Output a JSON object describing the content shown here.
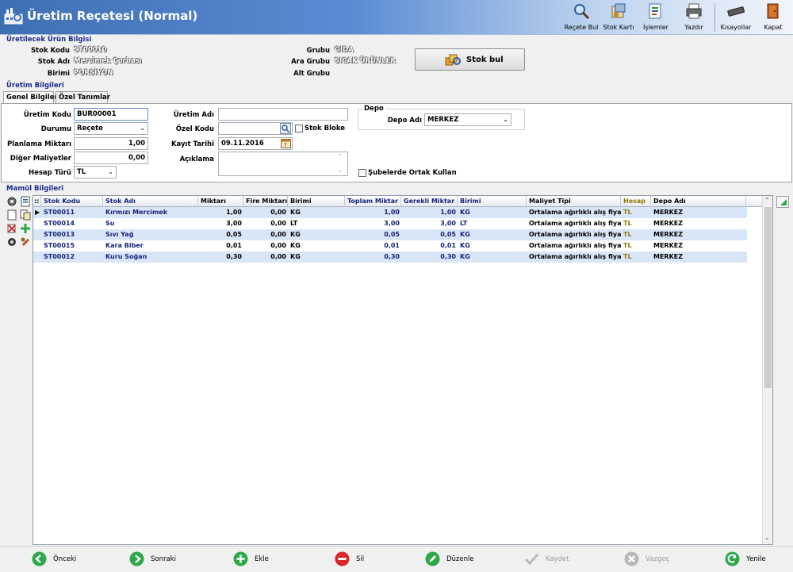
{
  "window": {
    "title": "Üretim Reçetesi (Normal)"
  },
  "toolbar": {
    "items": [
      {
        "label": "Reçete Bul",
        "icon": "magnifier-icon"
      },
      {
        "label": "Stok Kartı",
        "icon": "stock-card-icon"
      },
      {
        "label": "İşlemler",
        "icon": "operations-icon"
      },
      {
        "label": "Yazdır",
        "icon": "printer-icon"
      },
      {
        "label": "Kısayollar",
        "icon": "keyboard-icon"
      },
      {
        "label": "Kapat",
        "icon": "exit-door-icon"
      }
    ]
  },
  "product_info": {
    "section_title": "Üretilecek Ürün Bilgisi",
    "stok_kodu_label": "Stok Kodu",
    "stok_kodu": "ST00010",
    "stok_adi_label": "Stok Adı",
    "stok_adi": "Mercimek Çorbası",
    "birimi_label": "Birimi",
    "birimi": "PORSİYON",
    "grubu_label": "Grubu",
    "grubu": "GIDA",
    "ara_grubu_label": "Ara Grubu",
    "ara_grubu": "SICAK ÜRÜNLER",
    "alt_grubu_label": "Alt Grubu",
    "alt_grubu": "",
    "stok_bul_button": "Stok bul"
  },
  "production_info": {
    "section_title": "Üretim Bilgileri",
    "tabs": [
      {
        "label": "Genel Bilgiler",
        "active": true
      },
      {
        "label": "Özel Tanımlar",
        "active": false
      }
    ],
    "uretim_kodu_label": "Üretim Kodu",
    "uretim_kodu": "BUR00001",
    "durumu_label": "Durumu",
    "durumu": "Reçete",
    "planlama_miktari_label": "Planlama Miktarı",
    "planlama_miktari": "1,00",
    "diger_maliyetler_label": "Diğer Maliyetler",
    "diger_maliyetler": "0,00",
    "hesap_turu_label": "Hesap Türü",
    "hesap_turu": "TL",
    "uretim_adi_label": "Üretim Adı",
    "uretim_adi": "",
    "ozel_kodu_label": "Özel Kodu",
    "ozel_kodu": "",
    "stok_bloke_label": "Stok Bloke",
    "kayit_tarihi_label": "Kayıt Tarihi",
    "kayit_tarihi": "09.11.2016",
    "aciklama_label": "Açıklama",
    "aciklama": "",
    "depo_group_label": "Depo",
    "depo_adi_label": "Depo Adı",
    "depo_adi": "MERKEZ",
    "subelerde_label": "Şubelerde Ortak Kullan"
  },
  "materials": {
    "section_title": "Mamül Bilgileri",
    "columns": [
      "Stok Kodu",
      "Stok Adı",
      "Miktarı",
      "Fire Miktarı",
      "Birimi",
      "Toplam Miktar",
      "Gerekli Miktar",
      "Birimi",
      "Maliyet Tipi",
      "Hesap",
      "Depo Adı"
    ],
    "rows": [
      [
        "ST00011",
        "Kırmızı Mercimek",
        "1,00",
        "0,00",
        "KG",
        "1,00",
        "1,00",
        "KG",
        "Ortalama ağırlıklı alış fiyatı",
        "TL",
        "MERKEZ"
      ],
      [
        "ST00014",
        "Su",
        "3,00",
        "0,00",
        "LT",
        "3,00",
        "3,00",
        "LT",
        "Ortalama ağırlıklı alış fiyatı",
        "TL",
        "MERKEZ"
      ],
      [
        "ST00013",
        "Sıvı Yağ",
        "0,05",
        "0,00",
        "KG",
        "0,05",
        "0,05",
        "KG",
        "Ortalama ağırlıklı alış fiyatı",
        "TL",
        "MERKEZ"
      ],
      [
        "ST00015",
        "Kara Biber",
        "0,01",
        "0,00",
        "KG",
        "0,01",
        "0,01",
        "KG",
        "Ortalama ağırlıklı alış fiyatı",
        "TL",
        "MERKEZ"
      ],
      [
        "ST00012",
        "Kuru Soğan",
        "0,30",
        "0,00",
        "KG",
        "0,30",
        "0,30",
        "KG",
        "Ortalama ağırlıklı alış fiyatı",
        "TL",
        "MERKEZ"
      ]
    ]
  },
  "footer": {
    "buttons": [
      {
        "label": "Önceki",
        "color": "#2fa84a",
        "enabled": true
      },
      {
        "label": "Sonraki",
        "color": "#2fa84a",
        "enabled": true
      },
      {
        "label": "Ekle",
        "color": "#2fa84a",
        "enabled": true
      },
      {
        "label": "Sil",
        "color": "#d8262a",
        "enabled": true
      },
      {
        "label": "Düzenle",
        "color": "#2fa84a",
        "enabled": true
      },
      {
        "label": "Kaydet",
        "color": "#b8b8b8",
        "enabled": false
      },
      {
        "label": "Vazgeç",
        "color": "#b8b8b8",
        "enabled": false
      },
      {
        "label": "Yenile",
        "color": "#2fa84a",
        "enabled": true
      }
    ]
  },
  "colors": {
    "title_gradient_start": "#3f6fb3",
    "section_title": "#1a2a8c",
    "row_text": "#16237a",
    "alt_row": "#d8e6f8",
    "hesap_header": "#8a7a00"
  }
}
